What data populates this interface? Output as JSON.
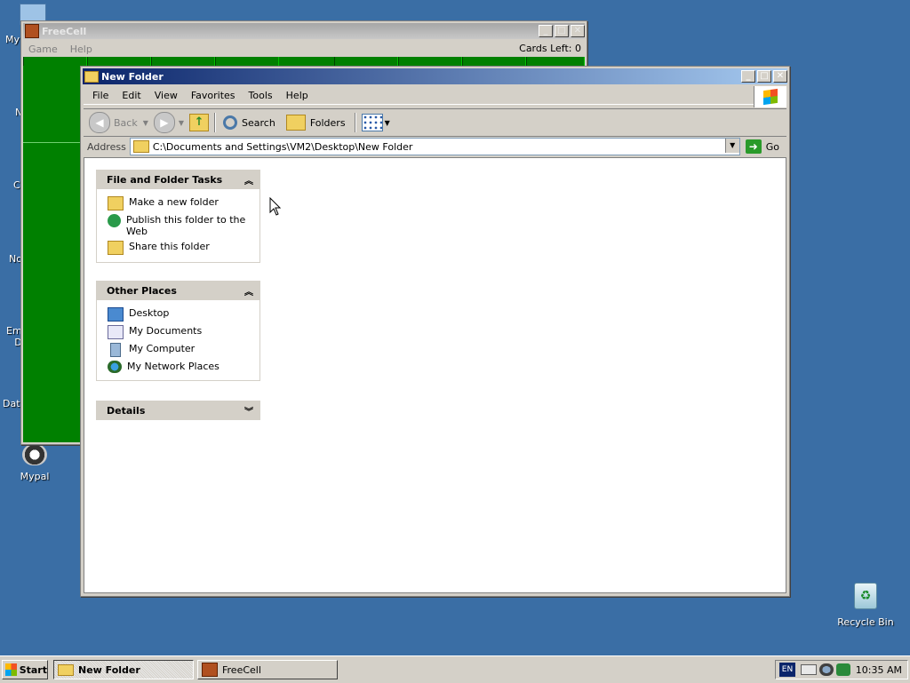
{
  "desktop": {
    "icons": [
      {
        "label": "My"
      },
      {
        "label": "N"
      },
      {
        "label": "C"
      },
      {
        "label": "No"
      },
      {
        "label": "Em\nD"
      },
      {
        "label": "Data"
      },
      {
        "label": "Mypal"
      },
      {
        "label": "Recycle Bin"
      }
    ]
  },
  "freecell": {
    "title": "FreeCell",
    "menu": [
      "Game",
      "Help"
    ],
    "cards_left": "Cards Left: 0"
  },
  "explorer": {
    "title": "New Folder",
    "menu": [
      "File",
      "Edit",
      "View",
      "Favorites",
      "Tools",
      "Help"
    ],
    "toolbar": {
      "back": "Back",
      "search": "Search",
      "folders": "Folders"
    },
    "address": {
      "label": "Address",
      "value": "C:\\Documents and Settings\\VM2\\Desktop\\New Folder",
      "go": "Go"
    },
    "panels": {
      "tasks": {
        "title": "File and Folder Tasks",
        "items": [
          "Make a new folder",
          "Publish this folder to the Web",
          "Share this folder"
        ]
      },
      "places": {
        "title": "Other Places",
        "items": [
          "Desktop",
          "My Documents",
          "My Computer",
          "My Network Places"
        ]
      },
      "details": {
        "title": "Details"
      }
    }
  },
  "taskbar": {
    "start": "Start",
    "tasks": [
      "New Folder",
      "FreeCell"
    ],
    "lang": "EN",
    "clock": "10:35 AM"
  }
}
